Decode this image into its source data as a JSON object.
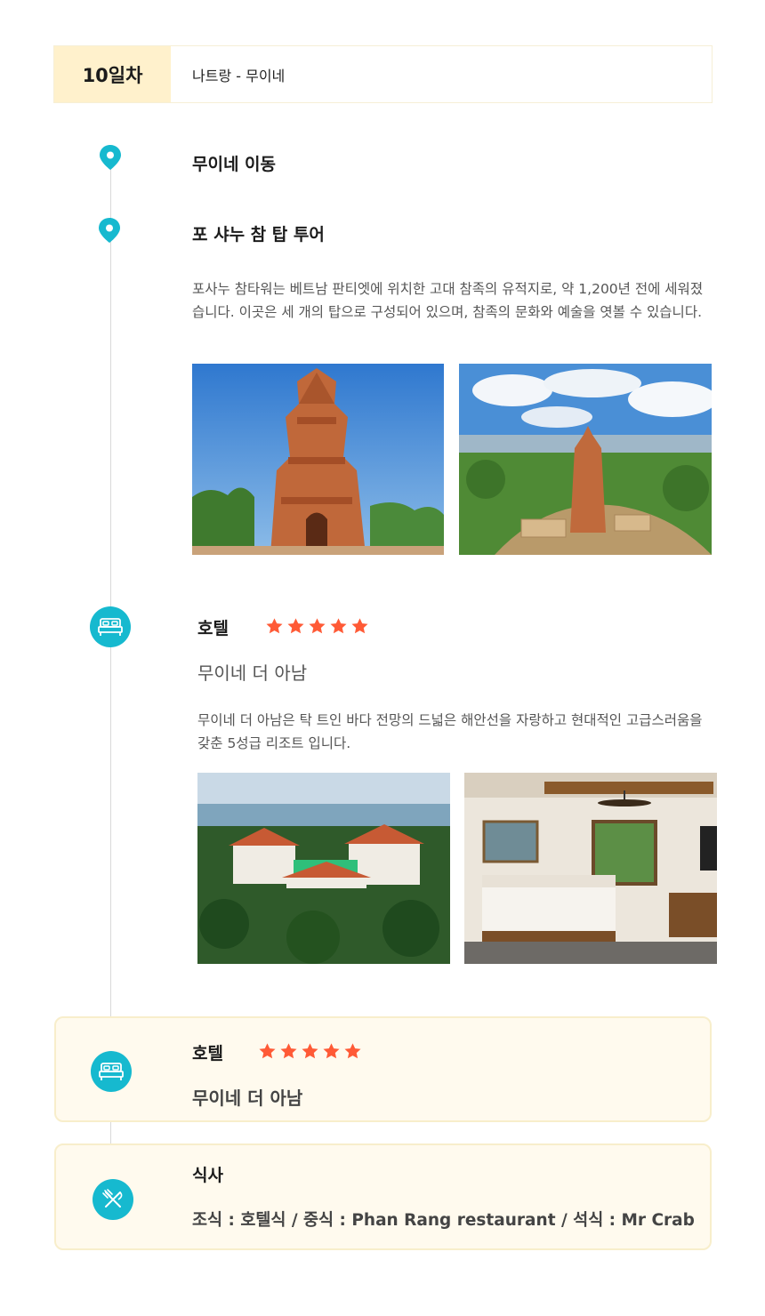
{
  "day": {
    "badge": "10일차",
    "route": "나트랑 - 무이네"
  },
  "steps": [
    {
      "title": "무이네 이동"
    },
    {
      "title": "포 샤누 참 탑 투어",
      "description": "포사누 참타워는 베트남 판티엣에 위치한 고대 참족의 유적지로, 약 1,200년 전에 세워졌습니다. 이곳은 세 개의 탑으로 구성되어 있으며, 참족의 문화와 예술을 엿볼 수 있습니다."
    }
  ],
  "hotel_detail": {
    "label": "호텔",
    "stars": 5,
    "name": "무이네 더 아남",
    "description": "무이네 더 아남은 탁 트인 바다 전망의 드넓은 해안선을 자랑하고 현대적인 고급스러움을 갖춘 5성급 리조트 입니다."
  },
  "hotel_card": {
    "label": "호텔",
    "stars": 5,
    "name": "무이네 더 아남"
  },
  "meal_card": {
    "label": "식사",
    "text": "조식 : 호텔식 / 중식 :  Phan Rang restaurant / 석식 : Mr Crab"
  },
  "colors": {
    "accent": "#16b9cf",
    "star": "#ff5a36",
    "badge_bg": "#fff1cc",
    "card_bg": "#fffaee",
    "card_border": "#f8eecb"
  },
  "icons": [
    "location-pin-icon",
    "bed-icon",
    "fork-knife-icon",
    "star-icon"
  ]
}
